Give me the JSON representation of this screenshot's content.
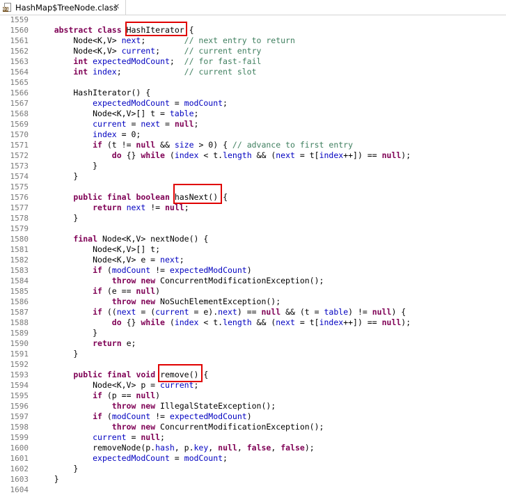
{
  "tab": {
    "title": "HashMap$TreeNode.class",
    "close": "✕"
  },
  "lines": [
    {
      "n": "1559",
      "t": []
    },
    {
      "n": "1560",
      "t": [
        [
          "",
          "    "
        ],
        [
          "kw",
          "abstract"
        ],
        [
          "",
          " "
        ],
        [
          "kw",
          "class"
        ],
        [
          "",
          " HashIterator {"
        ]
      ]
    },
    {
      "n": "1561",
      "t": [
        [
          "",
          "        Node<K,V> "
        ],
        [
          "fld",
          "next"
        ],
        [
          "",
          ";        "
        ],
        [
          "cmt",
          "// next entry to return"
        ]
      ]
    },
    {
      "n": "1562",
      "t": [
        [
          "",
          "        Node<K,V> "
        ],
        [
          "fld",
          "current"
        ],
        [
          "",
          ";     "
        ],
        [
          "cmt",
          "// current entry"
        ]
      ]
    },
    {
      "n": "1563",
      "t": [
        [
          "",
          "        "
        ],
        [
          "kw",
          "int"
        ],
        [
          "",
          " "
        ],
        [
          "fld",
          "expectedModCount"
        ],
        [
          "",
          ";  "
        ],
        [
          "cmt",
          "// for fast-fail"
        ]
      ]
    },
    {
      "n": "1564",
      "t": [
        [
          "",
          "        "
        ],
        [
          "kw",
          "int"
        ],
        [
          "",
          " "
        ],
        [
          "fld",
          "index"
        ],
        [
          "",
          ";             "
        ],
        [
          "cmt",
          "// current slot"
        ]
      ]
    },
    {
      "n": "1565",
      "t": []
    },
    {
      "n": "1566",
      "t": [
        [
          "",
          "        HashIterator() {"
        ]
      ]
    },
    {
      "n": "1567",
      "t": [
        [
          "",
          "            "
        ],
        [
          "fld",
          "expectedModCount"
        ],
        [
          "",
          " = "
        ],
        [
          "fld",
          "modCount"
        ],
        [
          "",
          ";"
        ]
      ]
    },
    {
      "n": "1568",
      "t": [
        [
          "",
          "            Node<K,V>[] t = "
        ],
        [
          "fld",
          "table"
        ],
        [
          "",
          ";"
        ]
      ]
    },
    {
      "n": "1569",
      "t": [
        [
          "",
          "            "
        ],
        [
          "fld",
          "current"
        ],
        [
          "",
          " = "
        ],
        [
          "fld",
          "next"
        ],
        [
          "",
          " = "
        ],
        [
          "kw",
          "null"
        ],
        [
          "",
          ";"
        ]
      ]
    },
    {
      "n": "1570",
      "t": [
        [
          "",
          "            "
        ],
        [
          "fld",
          "index"
        ],
        [
          "",
          " = 0;"
        ]
      ]
    },
    {
      "n": "1571",
      "t": [
        [
          "",
          "            "
        ],
        [
          "kw",
          "if"
        ],
        [
          "",
          " (t != "
        ],
        [
          "kw",
          "null"
        ],
        [
          "",
          " && "
        ],
        [
          "fld",
          "size"
        ],
        [
          "",
          " > 0) { "
        ],
        [
          "cmt",
          "// advance to first entry"
        ]
      ]
    },
    {
      "n": "1572",
      "t": [
        [
          "",
          "                "
        ],
        [
          "kw",
          "do"
        ],
        [
          "",
          " {} "
        ],
        [
          "kw",
          "while"
        ],
        [
          "",
          " ("
        ],
        [
          "fld",
          "index"
        ],
        [
          "",
          " < t."
        ],
        [
          "fld",
          "length"
        ],
        [
          "",
          " && ("
        ],
        [
          "fld",
          "next"
        ],
        [
          "",
          " = t["
        ],
        [
          "fld",
          "index"
        ],
        [
          "",
          "++]) == "
        ],
        [
          "kw",
          "null"
        ],
        [
          "",
          ");"
        ]
      ]
    },
    {
      "n": "1573",
      "t": [
        [
          "",
          "            }"
        ]
      ]
    },
    {
      "n": "1574",
      "t": [
        [
          "",
          "        }"
        ]
      ]
    },
    {
      "n": "1575",
      "t": []
    },
    {
      "n": "1576",
      "t": [
        [
          "",
          "        "
        ],
        [
          "kw",
          "public"
        ],
        [
          "",
          " "
        ],
        [
          "kw",
          "final"
        ],
        [
          "",
          " "
        ],
        [
          "kw",
          "boolean"
        ],
        [
          "",
          " hasNext() {"
        ]
      ]
    },
    {
      "n": "1577",
      "t": [
        [
          "",
          "            "
        ],
        [
          "kw",
          "return"
        ],
        [
          "",
          " "
        ],
        [
          "fld",
          "next"
        ],
        [
          "",
          " != "
        ],
        [
          "kw",
          "null"
        ],
        [
          "",
          ";"
        ]
      ]
    },
    {
      "n": "1578",
      "t": [
        [
          "",
          "        }"
        ]
      ]
    },
    {
      "n": "1579",
      "t": []
    },
    {
      "n": "1580",
      "t": [
        [
          "",
          "        "
        ],
        [
          "kw",
          "final"
        ],
        [
          "",
          " Node<K,V> nextNode() {"
        ]
      ]
    },
    {
      "n": "1581",
      "t": [
        [
          "",
          "            Node<K,V>[] t;"
        ]
      ]
    },
    {
      "n": "1582",
      "t": [
        [
          "",
          "            Node<K,V> e = "
        ],
        [
          "fld",
          "next"
        ],
        [
          "",
          ";"
        ]
      ]
    },
    {
      "n": "1583",
      "t": [
        [
          "",
          "            "
        ],
        [
          "kw",
          "if"
        ],
        [
          "",
          " ("
        ],
        [
          "fld",
          "modCount"
        ],
        [
          "",
          " != "
        ],
        [
          "fld",
          "expectedModCount"
        ],
        [
          "",
          ")"
        ]
      ]
    },
    {
      "n": "1584",
      "t": [
        [
          "",
          "                "
        ],
        [
          "kw",
          "throw"
        ],
        [
          "",
          " "
        ],
        [
          "kw",
          "new"
        ],
        [
          "",
          " ConcurrentModificationException();"
        ]
      ]
    },
    {
      "n": "1585",
      "t": [
        [
          "",
          "            "
        ],
        [
          "kw",
          "if"
        ],
        [
          "",
          " (e == "
        ],
        [
          "kw",
          "null"
        ],
        [
          "",
          ")"
        ]
      ]
    },
    {
      "n": "1586",
      "t": [
        [
          "",
          "                "
        ],
        [
          "kw",
          "throw"
        ],
        [
          "",
          " "
        ],
        [
          "kw",
          "new"
        ],
        [
          "",
          " NoSuchElementException();"
        ]
      ]
    },
    {
      "n": "1587",
      "t": [
        [
          "",
          "            "
        ],
        [
          "kw",
          "if"
        ],
        [
          "",
          " (("
        ],
        [
          "fld",
          "next"
        ],
        [
          "",
          " = ("
        ],
        [
          "fld",
          "current"
        ],
        [
          "",
          " = e)."
        ],
        [
          "fld",
          "next"
        ],
        [
          "",
          ") == "
        ],
        [
          "kw",
          "null"
        ],
        [
          "",
          " && (t = "
        ],
        [
          "fld",
          "table"
        ],
        [
          "",
          ") != "
        ],
        [
          "kw",
          "null"
        ],
        [
          "",
          ") {"
        ]
      ]
    },
    {
      "n": "1588",
      "t": [
        [
          "",
          "                "
        ],
        [
          "kw",
          "do"
        ],
        [
          "",
          " {} "
        ],
        [
          "kw",
          "while"
        ],
        [
          "",
          " ("
        ],
        [
          "fld",
          "index"
        ],
        [
          "",
          " < t."
        ],
        [
          "fld",
          "length"
        ],
        [
          "",
          " && ("
        ],
        [
          "fld",
          "next"
        ],
        [
          "",
          " = t["
        ],
        [
          "fld",
          "index"
        ],
        [
          "",
          "++]) == "
        ],
        [
          "kw",
          "null"
        ],
        [
          "",
          ");"
        ]
      ]
    },
    {
      "n": "1589",
      "t": [
        [
          "",
          "            }"
        ]
      ]
    },
    {
      "n": "1590",
      "t": [
        [
          "",
          "            "
        ],
        [
          "kw",
          "return"
        ],
        [
          "",
          " e;"
        ]
      ]
    },
    {
      "n": "1591",
      "t": [
        [
          "",
          "        }"
        ]
      ]
    },
    {
      "n": "1592",
      "t": []
    },
    {
      "n": "1593",
      "t": [
        [
          "",
          "        "
        ],
        [
          "kw",
          "public"
        ],
        [
          "",
          " "
        ],
        [
          "kw",
          "final"
        ],
        [
          "",
          " "
        ],
        [
          "kw",
          "void"
        ],
        [
          "",
          " remove() {"
        ]
      ]
    },
    {
      "n": "1594",
      "t": [
        [
          "",
          "            Node<K,V> p = "
        ],
        [
          "fld",
          "current"
        ],
        [
          "",
          ";"
        ]
      ]
    },
    {
      "n": "1595",
      "t": [
        [
          "",
          "            "
        ],
        [
          "kw",
          "if"
        ],
        [
          "",
          " (p == "
        ],
        [
          "kw",
          "null"
        ],
        [
          "",
          ")"
        ]
      ]
    },
    {
      "n": "1596",
      "t": [
        [
          "",
          "                "
        ],
        [
          "kw",
          "throw"
        ],
        [
          "",
          " "
        ],
        [
          "kw",
          "new"
        ],
        [
          "",
          " IllegalStateException();"
        ]
      ]
    },
    {
      "n": "1597",
      "t": [
        [
          "",
          "            "
        ],
        [
          "kw",
          "if"
        ],
        [
          "",
          " ("
        ],
        [
          "fld",
          "modCount"
        ],
        [
          "",
          " != "
        ],
        [
          "fld",
          "expectedModCount"
        ],
        [
          "",
          ")"
        ]
      ]
    },
    {
      "n": "1598",
      "t": [
        [
          "",
          "                "
        ],
        [
          "kw",
          "throw"
        ],
        [
          "",
          " "
        ],
        [
          "kw",
          "new"
        ],
        [
          "",
          " ConcurrentModificationException();"
        ]
      ]
    },
    {
      "n": "1599",
      "t": [
        [
          "",
          "            "
        ],
        [
          "fld",
          "current"
        ],
        [
          "",
          " = "
        ],
        [
          "kw",
          "null"
        ],
        [
          "",
          ";"
        ]
      ]
    },
    {
      "n": "1600",
      "t": [
        [
          "",
          "            removeNode(p."
        ],
        [
          "fld",
          "hash"
        ],
        [
          "",
          ", p."
        ],
        [
          "fld",
          "key"
        ],
        [
          "",
          ", "
        ],
        [
          "kw",
          "null"
        ],
        [
          "",
          ", "
        ],
        [
          "kw",
          "false"
        ],
        [
          "",
          ", "
        ],
        [
          "kw",
          "false"
        ],
        [
          "",
          ");"
        ]
      ]
    },
    {
      "n": "1601",
      "t": [
        [
          "",
          "            "
        ],
        [
          "fld",
          "expectedModCount"
        ],
        [
          "",
          " = "
        ],
        [
          "fld",
          "modCount"
        ],
        [
          "",
          ";"
        ]
      ]
    },
    {
      "n": "1602",
      "t": [
        [
          "",
          "        }"
        ]
      ]
    },
    {
      "n": "1603",
      "t": [
        [
          "",
          "    }"
        ]
      ]
    },
    {
      "n": "1604",
      "t": []
    }
  ]
}
